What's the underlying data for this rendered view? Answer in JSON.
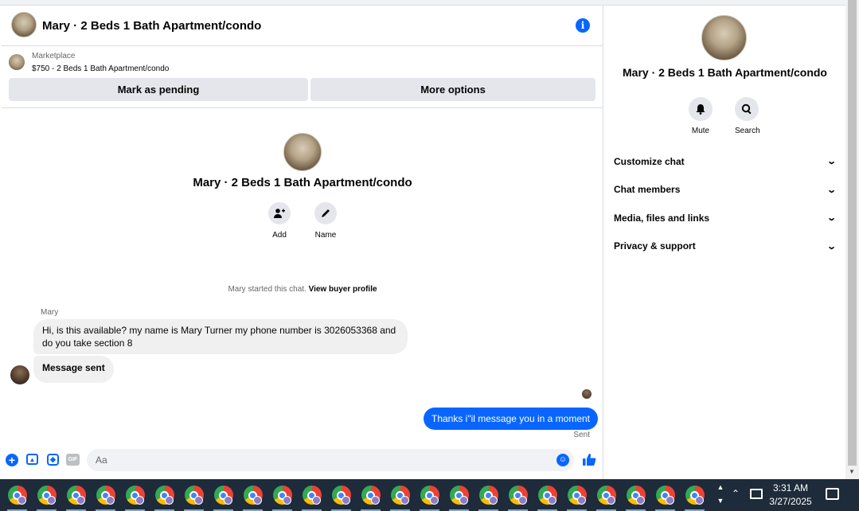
{
  "chat": {
    "title": "Mary · 2 Beds 1 Bath Apartment/condo",
    "info_icon": "i",
    "listing": {
      "source": "Marketplace",
      "price_title": "$750 - 2 Beds 1 Bath Apartment/condo",
      "mark_pending": "Mark as pending",
      "more_options": "More options"
    },
    "header": {
      "name": "Mary · 2 Beds 1 Bath Apartment/condo",
      "add_label": "Add",
      "name_label": "Name"
    },
    "started_text": "Mary started this chat.",
    "buyer_link": "View buyer profile",
    "sender_name": "Mary",
    "messages": [
      {
        "from": "Mary",
        "text": "Hi, is this available? my name is Mary Turner my phone number is 3026053368 and do you take section 8"
      },
      {
        "from": "Mary",
        "text": "Message sent"
      },
      {
        "from": "me",
        "text": "Thanks i\"il message you in a moment"
      }
    ],
    "sent_status": "Sent",
    "composer_placeholder": "Aa"
  },
  "sidebar": {
    "name": "Mary · 2 Beds 1 Bath Apartment/condo",
    "mute_label": "Mute",
    "search_label": "Search",
    "menu": [
      {
        "label": "Customize chat"
      },
      {
        "label": "Chat members"
      },
      {
        "label": "Media, files and links"
      },
      {
        "label": "Privacy & support"
      }
    ]
  },
  "taskbar": {
    "time": "3:31 AM",
    "date": "3/27/2025"
  }
}
